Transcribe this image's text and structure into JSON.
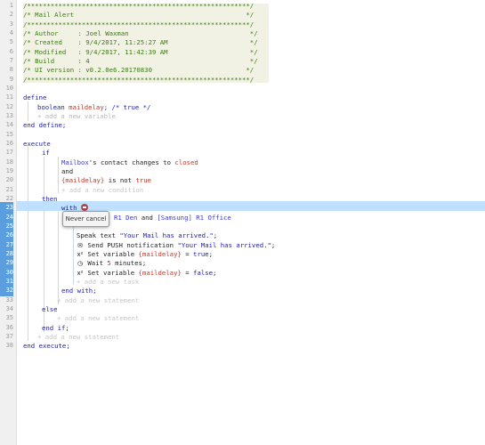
{
  "gutter_numbers": [
    "1",
    "2",
    "3",
    "4",
    "5",
    "6",
    "7",
    "8",
    "9",
    "10",
    "11",
    "12",
    "13",
    "14",
    "15",
    "16",
    "17",
    "18",
    "19",
    "20",
    "21",
    "22",
    "23",
    "24",
    "25",
    "26",
    "27",
    "28",
    "29",
    "30",
    "31",
    "32",
    "33",
    "34",
    "35",
    "36",
    "37",
    "38"
  ],
  "header": {
    "line1": "/*********************************************************/",
    "line2": "/* Mail Alert                                            */",
    "line3": "/*********************************************************/",
    "author": "/* Author     : Joel Waxman                               */",
    "created": "/* Created    : 9/4/2017, 11:25:27 AM                     */",
    "modified": "/* Modified   : 9/4/2017, 11:42:39 AM                     */",
    "build": "/* Build      : 4                                         */",
    "ui_version": "/* UI version : v0.2.0e6.20170830                        */",
    "line9": "/*********************************************************/"
  },
  "define": {
    "keyword": "define",
    "type": "boolean",
    "var_name": "maildelay",
    "suffix": "; /* true */",
    "add_variable": "+ add a new variable",
    "end": "end define;"
  },
  "execute": {
    "keyword": "execute",
    "if_kw": "if",
    "cond1_device": "Mailbox",
    "cond1_text": "'s contact changes to ",
    "cond1_value": "closed",
    "and_kw": "and",
    "cond2_var": "{maildelay}",
    "cond2_text": " is not ",
    "cond2_value": "true",
    "add_condition": "+ add a new condition",
    "then_kw": "then",
    "with_kw": "with",
    "with_devices_dev1": "R1 Den",
    "with_devices_and": " and ",
    "with_devices_dev2": "[Samsung] R1 Office",
    "speak_prefix": "Speak text ",
    "speak_str": "\"Your Mail has arrived.\"",
    "speak_suffix": ";",
    "push_prefix": "Send PUSH notification ",
    "push_str": "\"Your Mail has arrived.\"",
    "push_suffix": ";",
    "set1_prefix": "Set variable ",
    "set1_var": "{maildelay}",
    "set1_mid": " = ",
    "set1_val": "true",
    "set1_suffix": ";",
    "wait_prefix": "Wait ",
    "wait_num": "5",
    "wait_suffix": " minutes;",
    "set2_prefix": "Set variable ",
    "set2_var": "{maildelay}",
    "set2_mid": " = ",
    "set2_val": "false",
    "set2_suffix": ";",
    "add_task": "+ add a new task",
    "end_with": "end with;",
    "add_statement_inner": "+ add a new statement",
    "else_kw": "else",
    "add_statement_else": "+ add a new statement",
    "end_if": "end if;",
    "add_statement_outer": "+ add a new statement",
    "end_execute": "end execute;"
  },
  "tooltip": "Never cancel",
  "icons": {
    "with_icon": "cancel-icon",
    "push_icon": "chat-bubble-icon",
    "set_icon": "variable-x-icon",
    "wait_icon": "clock-icon"
  },
  "colors": {
    "comment": "#3a7a12",
    "keyword": "#1b1bb0",
    "variable": "#c0392b",
    "highlight": "#bfe0ff",
    "gutter_selected": "#5a9ee0"
  }
}
